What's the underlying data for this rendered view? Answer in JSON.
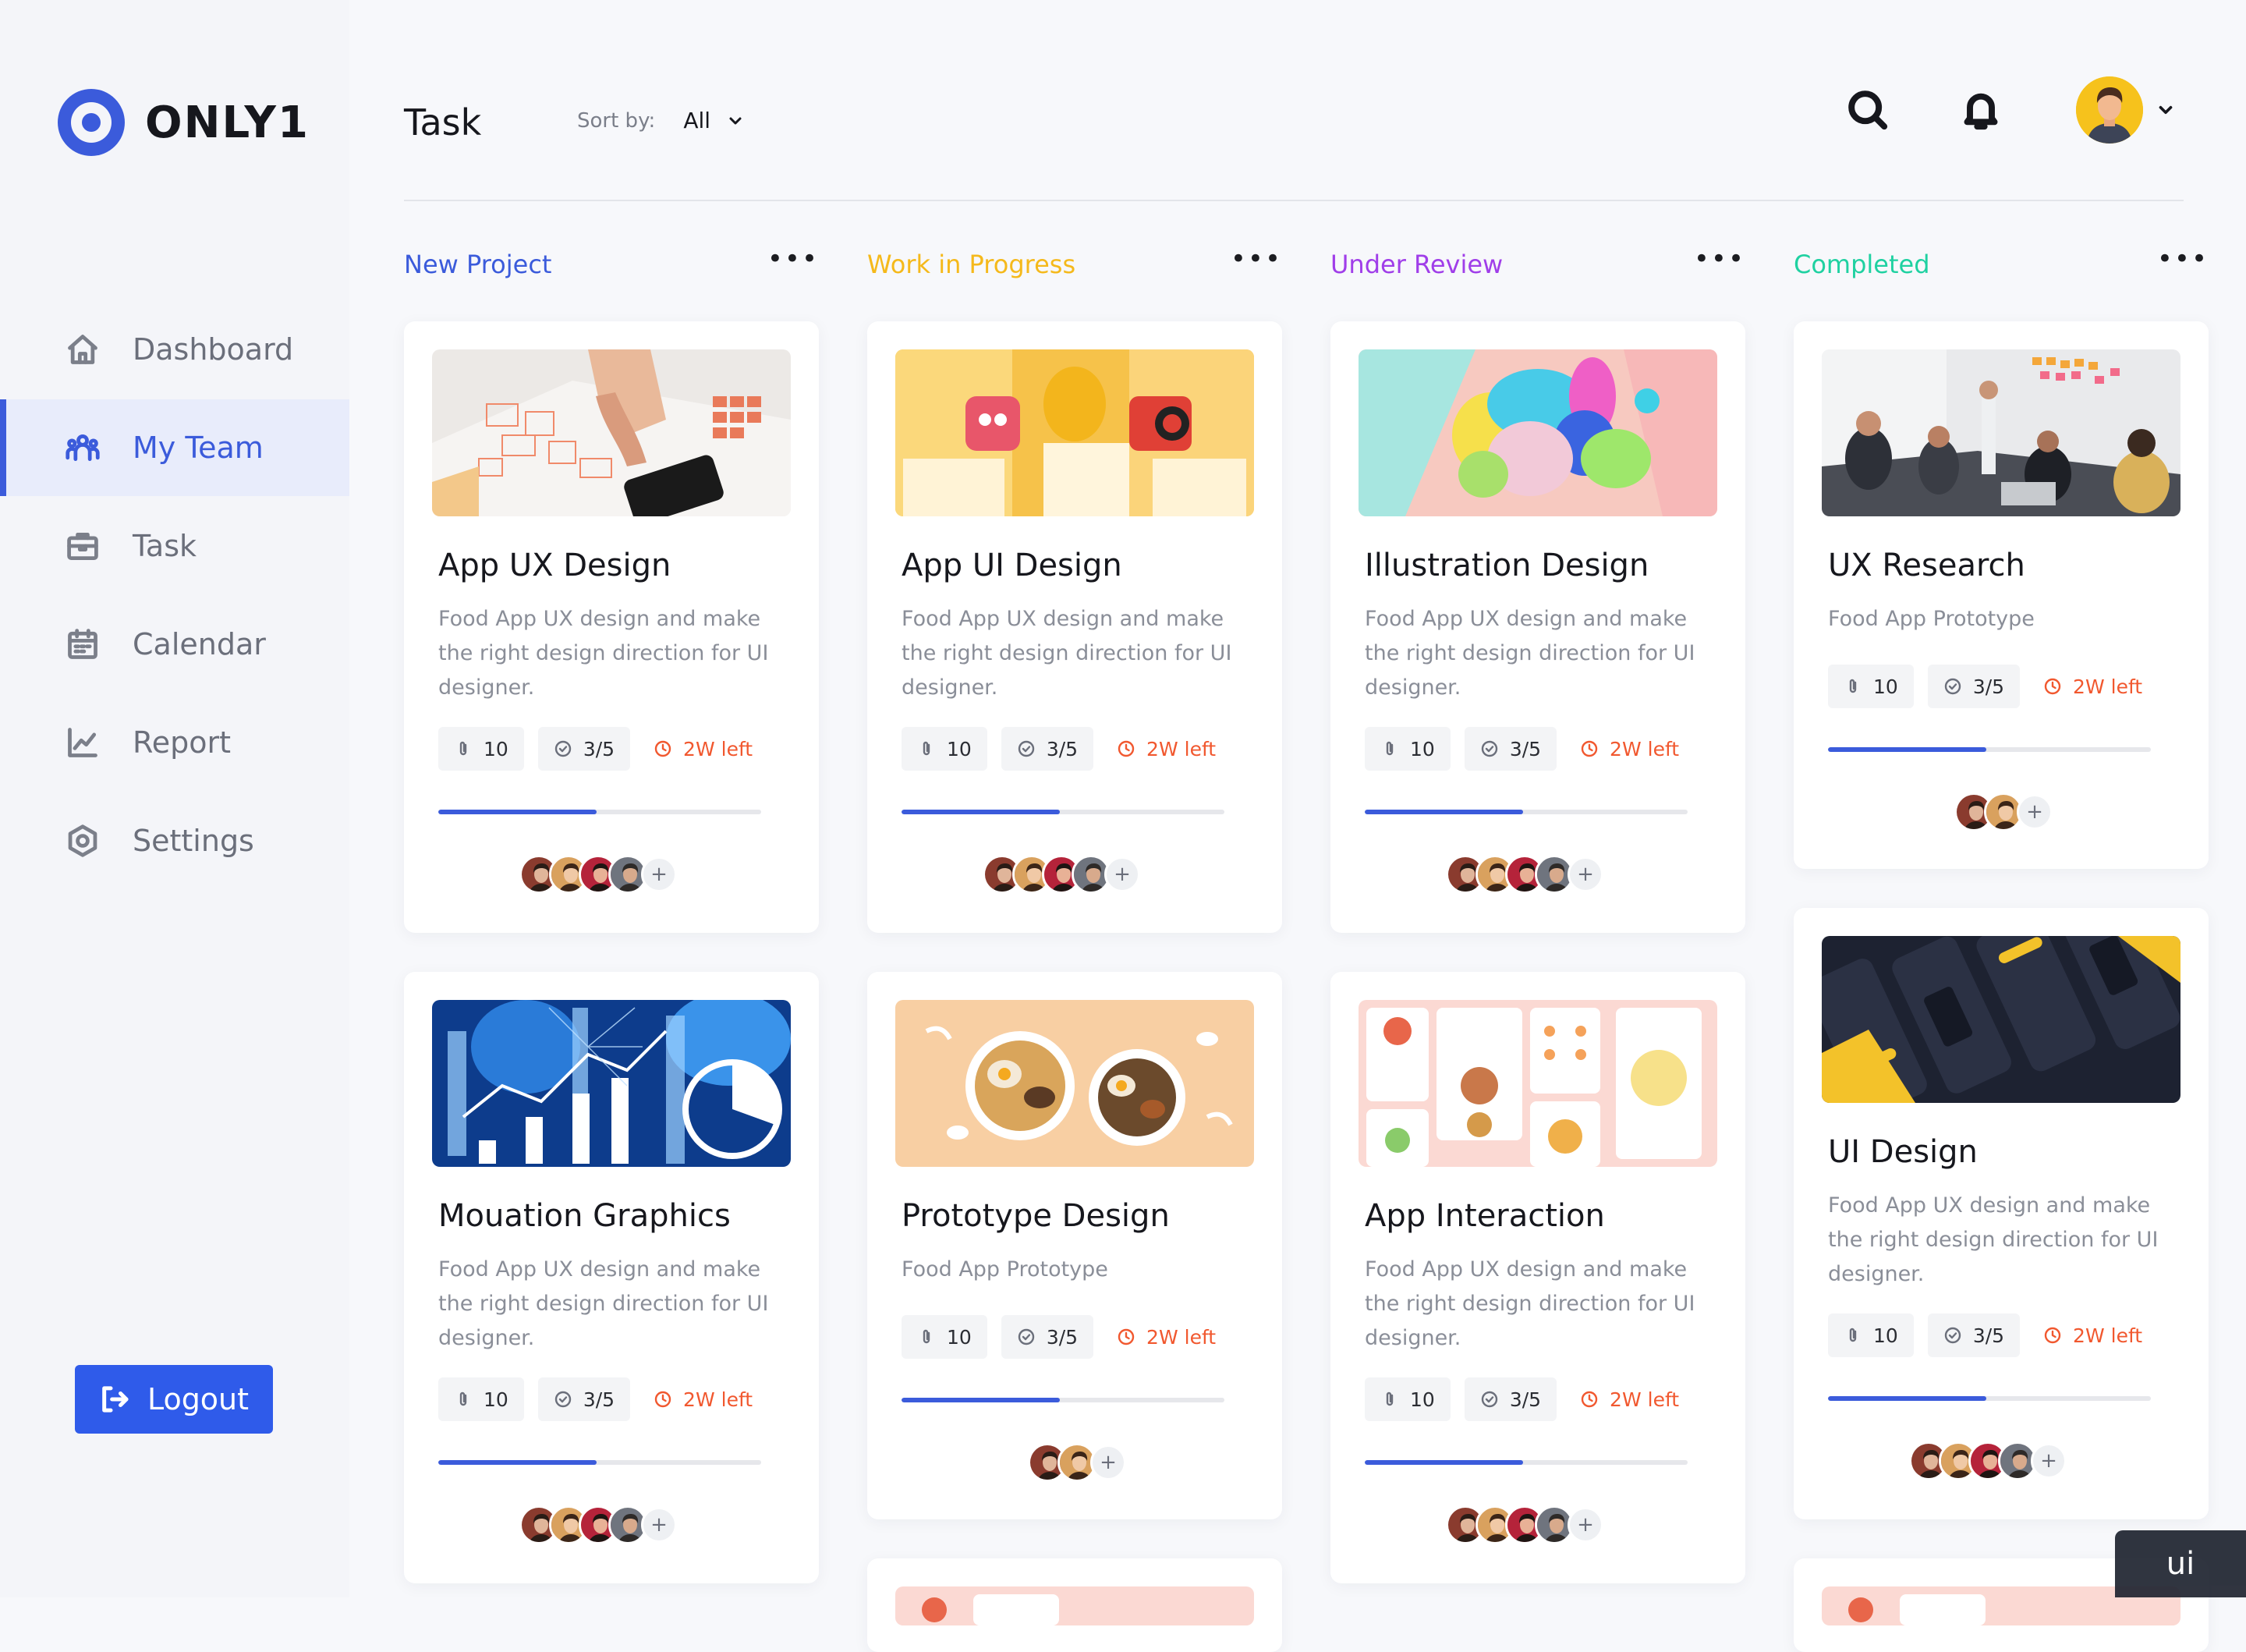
{
  "app": {
    "name": "ONLY1"
  },
  "sidebar": {
    "items": [
      {
        "label": "Dashboard",
        "icon": "home-icon"
      },
      {
        "label": "My Team",
        "icon": "team-icon",
        "active": true
      },
      {
        "label": "Task",
        "icon": "briefcase-icon"
      },
      {
        "label": "Calendar",
        "icon": "calendar-icon"
      },
      {
        "label": "Report",
        "icon": "chart-line-icon"
      },
      {
        "label": "Settings",
        "icon": "settings-icon"
      }
    ],
    "logout_label": "Logout"
  },
  "header": {
    "title": "Task",
    "sort_label": "Sort by:",
    "sort_value": "All"
  },
  "colors": {
    "accent": "#3b5bdb",
    "new_project": "#3b5bdb",
    "in_progress": "#f5b91b",
    "under_review": "#a03ee9",
    "completed": "#1fd1a1",
    "due": "#f1582f"
  },
  "columns": [
    {
      "title": "New Project",
      "color": "#3b5bdb"
    },
    {
      "title": "Work in Progress",
      "color": "#f5b91b"
    },
    {
      "title": "Under Review",
      "color": "#a03ee9"
    },
    {
      "title": "Completed",
      "color": "#1fd1a1"
    }
  ],
  "cards": [
    {
      "title": "App UX Design",
      "desc": "Food App UX design and make the right design direction for UI designer.",
      "attachments": "10",
      "tasks": "3/5",
      "due": "2W left",
      "progress": 0.49,
      "members": 4
    },
    {
      "title": "App UI Design",
      "desc": "Food App UX design and make the right design direction for UI designer.",
      "attachments": "10",
      "tasks": "3/5",
      "due": "2W left",
      "progress": 0.49,
      "members": 4
    },
    {
      "title": "Illustration Design",
      "desc": "Food App UX design and make the right design direction for UI designer.",
      "attachments": "10",
      "tasks": "3/5",
      "due": "2W left",
      "progress": 0.49,
      "members": 4
    },
    {
      "title": "UX Research",
      "desc": "Food App Prototype",
      "attachments": "10",
      "tasks": "3/5",
      "due": "2W left",
      "progress": 0.49,
      "members": 2
    },
    {
      "title": "Mouation Graphics",
      "desc": "Food App UX design and make the right design direction for UI designer.",
      "attachments": "10",
      "tasks": "3/5",
      "due": "2W left",
      "progress": 0.49,
      "members": 4
    },
    {
      "title": "Prototype Design",
      "desc": "Food App Prototype",
      "attachments": "10",
      "tasks": "3/5",
      "due": "2W left",
      "progress": 0.49,
      "members": 2
    },
    {
      "title": "App Interaction",
      "desc": "Food App UX design and make the right design direction for UI designer.",
      "attachments": "10",
      "tasks": "3/5",
      "due": "2W left",
      "progress": 0.49,
      "members": 4
    },
    {
      "title": "UI Design",
      "desc": "Food App UX design and make the right design direction for UI designer.",
      "attachments": "10",
      "tasks": "3/5",
      "due": "2W left",
      "progress": 0.49,
      "members": 4
    }
  ],
  "watermark": "ui"
}
